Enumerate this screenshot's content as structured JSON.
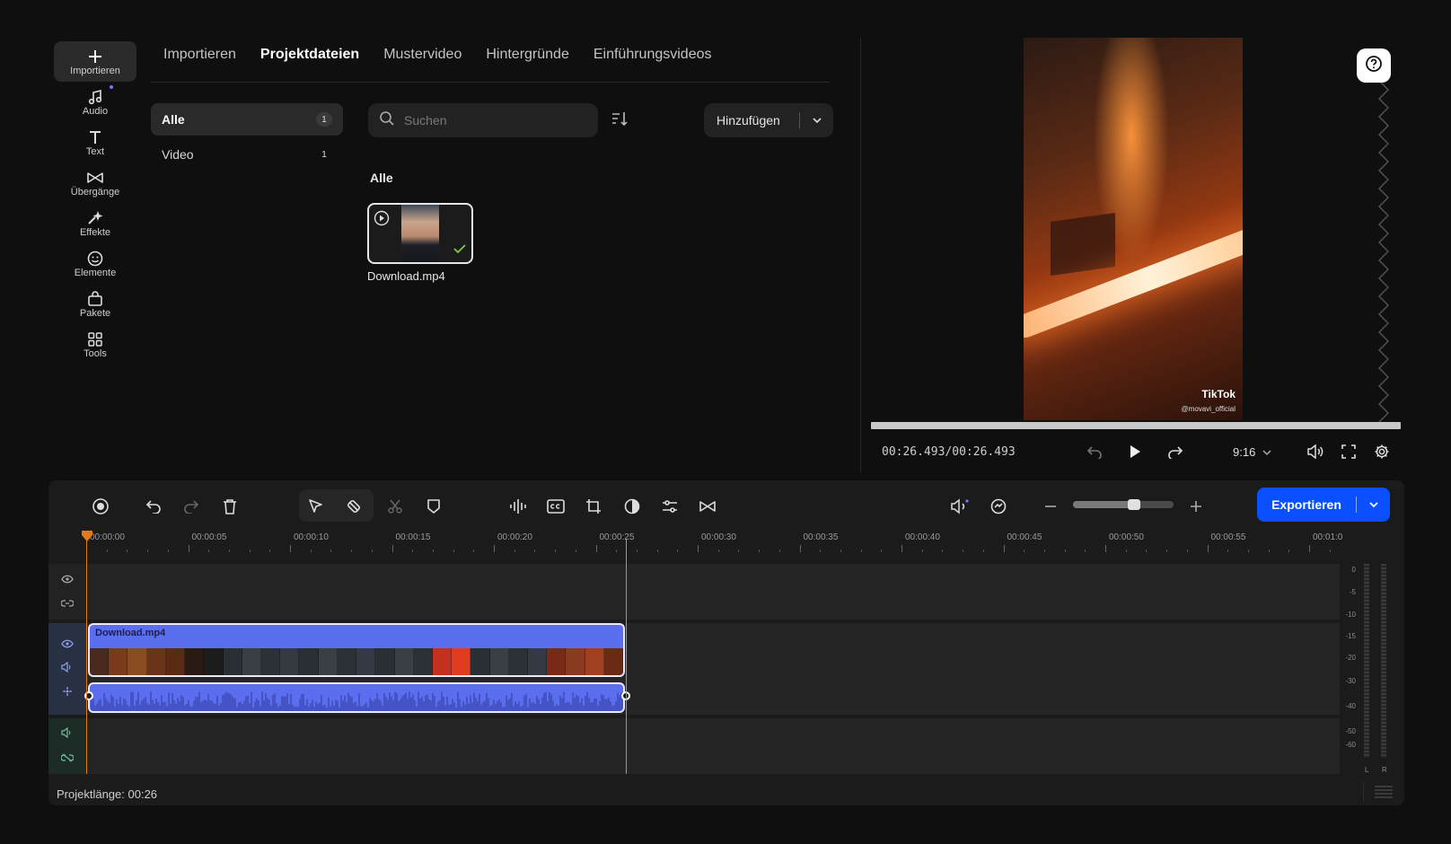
{
  "sidebar": {
    "items": [
      {
        "label": "Importieren",
        "icon": "plus-icon"
      },
      {
        "label": "Audio",
        "icon": "music-note-icon"
      },
      {
        "label": "Text",
        "icon": "text-icon"
      },
      {
        "label": "Übergänge",
        "icon": "transition-icon"
      },
      {
        "label": "Effekte",
        "icon": "sparkle-icon"
      },
      {
        "label": "Elemente",
        "icon": "smiley-icon"
      },
      {
        "label": "Pakete",
        "icon": "bag-icon"
      },
      {
        "label": "Tools",
        "icon": "grid-icon"
      }
    ]
  },
  "tabs": [
    "Importieren",
    "Projektdateien",
    "Mustervideo",
    "Hintergründe",
    "Einführungsvideos"
  ],
  "active_tab": "Projektdateien",
  "categories": [
    {
      "label": "Alle",
      "count": "1"
    },
    {
      "label": "Video",
      "count": "1"
    }
  ],
  "search": {
    "placeholder": "Suchen",
    "value": ""
  },
  "add_button": {
    "label": "Hinzufügen"
  },
  "media": {
    "section_label": "Alle",
    "files": [
      {
        "name": "Download.mp4"
      }
    ]
  },
  "preview": {
    "watermark": "TikTok",
    "watermark_handle": "@movavi_official",
    "timecode": "00:26.493/00:26.493",
    "aspect_ratio": "9:16",
    "progress": 1.0
  },
  "timeline": {
    "export_label": "Exportieren",
    "zoom_level": 0.6,
    "ruler_labels": [
      "00:00:00",
      "00:00:05",
      "00:00:10",
      "00:00:15",
      "00:00:20",
      "00:00:25",
      "00:00:30",
      "00:00:35",
      "00:00:40",
      "00:00:45",
      "00:00:50",
      "00:00:55",
      "00:01:0"
    ],
    "clip_name": "Download.mp4",
    "meter_labels": [
      "0",
      "-5",
      "-10",
      "-15",
      "-20",
      "-30",
      "-40",
      "-50",
      "-60"
    ],
    "meter_channels": [
      "L",
      "R"
    ],
    "project_length": "Projektlänge: 00:26"
  },
  "colors": {
    "accent": "#0a50ff",
    "clip": "#5c6ef0",
    "playhead": "#e07a1a"
  }
}
